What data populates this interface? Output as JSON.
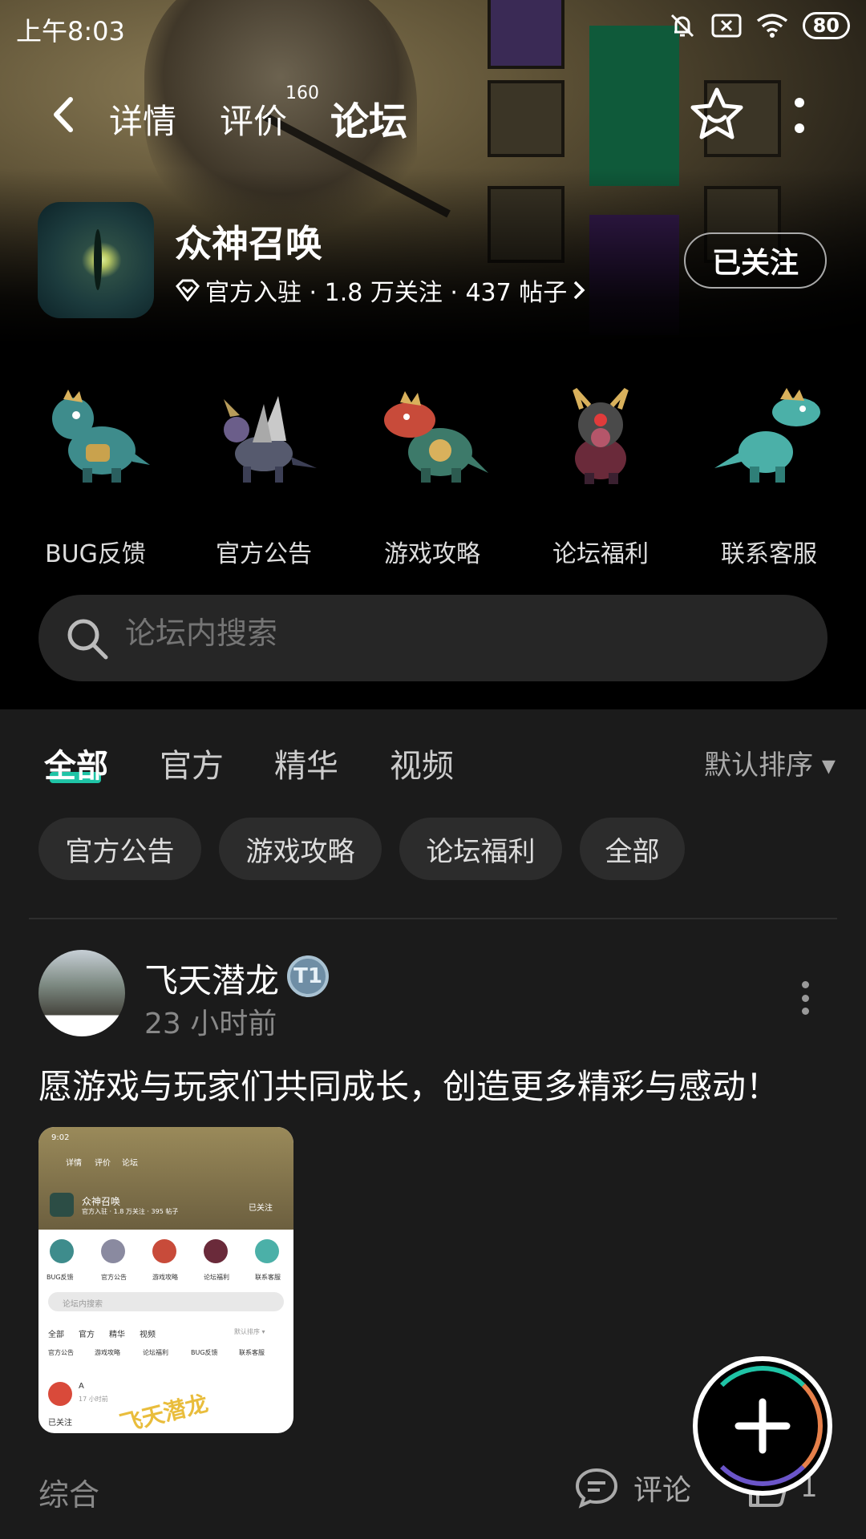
{
  "status_bar": {
    "time": "上午8:03",
    "battery": "80"
  },
  "nav": {
    "tabs": [
      {
        "label": "详情"
      },
      {
        "label": "评价",
        "count": "160"
      },
      {
        "label": "论坛"
      }
    ]
  },
  "game": {
    "title": "众神召唤",
    "meta": "官方入驻 · 1.8 万关注 · 437 帖子",
    "follow_label": "已关注"
  },
  "categories": [
    {
      "label": "BUG反馈",
      "color": "#3e8c8c"
    },
    {
      "label": "官方公告",
      "color": "#c9c9c9"
    },
    {
      "label": "游戏攻略",
      "color": "#c84b3a"
    },
    {
      "label": "论坛福利",
      "color": "#6a2a3a"
    },
    {
      "label": "联系客服",
      "color": "#4bb0a8"
    }
  ],
  "search": {
    "placeholder": "论坛内搜索"
  },
  "tabs": {
    "items": [
      "全部",
      "官方",
      "精华",
      "视频"
    ],
    "sort_label": "默认排序 ▾"
  },
  "chips": [
    "官方公告",
    "游戏攻略",
    "论坛福利",
    "全部"
  ],
  "post": {
    "author": "飞天潜龙",
    "level": "T1",
    "time": "23 小时前",
    "text": "愿游戏与玩家们共同成长，创造更多精彩与感动！",
    "thumbnail": {
      "time": "9:02",
      "nav": [
        "详情",
        "评价",
        "论坛"
      ],
      "game_title": "众神召唤",
      "game_meta": "官方入驻 · 1.8 万关注 · 395 帖子",
      "follow": "已关注",
      "categories": [
        "BUG反馈",
        "官方公告",
        "游戏攻略",
        "论坛福利",
        "联系客服"
      ],
      "search": "论坛内搜索",
      "tabs": [
        "全部",
        "官方",
        "精华",
        "视频"
      ],
      "sort": "默认排序 ▾",
      "chips": [
        "官方公告",
        "游戏攻略",
        "论坛福利",
        "BUG反馈",
        "联系客服"
      ],
      "post_author": "A",
      "post_time": "17 小时前",
      "follow_status": "已关注",
      "watermark": "飞天潜龙"
    },
    "footer_tag": "综合",
    "comment_label": "评论",
    "like_count": "1"
  },
  "colors": {
    "accent": "#1fc4a6",
    "background": "#1b1b1b"
  }
}
